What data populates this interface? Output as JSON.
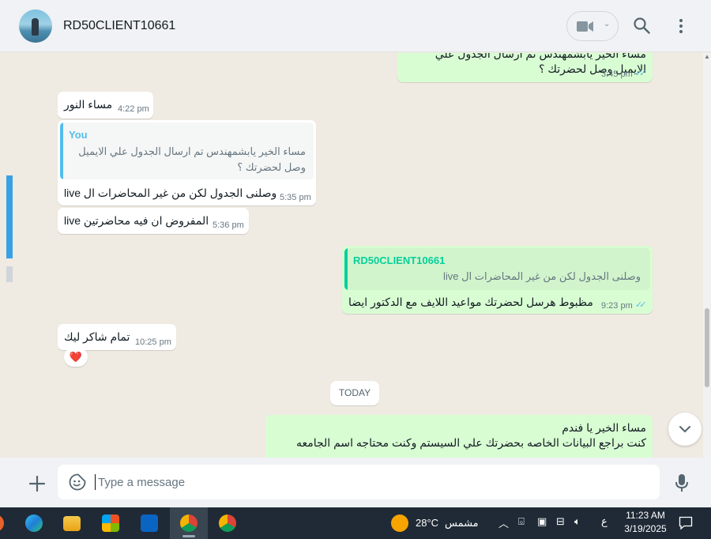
{
  "header": {
    "contact_name": "RD50CLIENT10661"
  },
  "messages": [
    {
      "dir": "out",
      "text": "مساء الخير يابشمهندس تم ارسال الجدول علي الايميل وصل لحضرتك ؟",
      "time": "3:45 pm",
      "status": "read"
    },
    {
      "dir": "in",
      "text": "مساء النور",
      "time": "4:22 pm"
    },
    {
      "dir": "in",
      "quote_author": "You",
      "quote_text": "مساء الخير يابشمهندس تم ارسال الجدول علي الايميل وصل لحضرتك ؟",
      "text": "وصلنى الجدول لكن من غير المحاضرات ال live",
      "time": "5:35 pm"
    },
    {
      "dir": "in",
      "text": "المفروض ان فيه محاضرتين live",
      "time": "5:36 pm"
    },
    {
      "dir": "out",
      "quote_author": "RD50CLIENT10661",
      "quote_text": "وصلنى الجدول لكن من غير المحاضرات ال live",
      "text": "مظبوط هرسل لحضرتك مواعيد اللايف مع الدكتور ايضا",
      "time": "9:23 pm",
      "status": "read"
    },
    {
      "dir": "in",
      "text": "تمام شاكر ليك",
      "time": "10:25 pm",
      "reaction": "❤️"
    },
    {
      "dir": "out",
      "text_line1": "مساء الخير يا فندم",
      "text_line2": "كنت براجع البيانات الخاصه بحضرتك علي السيستم وكنت محتاجه اسم الجامعه"
    }
  ],
  "date_divider": "TODAY",
  "composer": {
    "placeholder": "Type a message"
  },
  "taskbar": {
    "weather_temp": "28°C",
    "weather_desc": "مشمس",
    "lang": "ع",
    "time": "11:23 AM",
    "date": "3/19/2025"
  },
  "colors": {
    "outgoing_bubble": "#d9fdd3",
    "incoming_bubble": "#ffffff",
    "chat_bg": "#efeae2",
    "read_ticks": "#53bdeb",
    "quote_you": "#53bdeb",
    "quote_contact": "#06cf9c"
  },
  "icons": [
    "video-call-icon",
    "search-icon",
    "menu-icon",
    "plus-icon",
    "sticker-icon",
    "mic-icon",
    "chevron-down-icon"
  ]
}
